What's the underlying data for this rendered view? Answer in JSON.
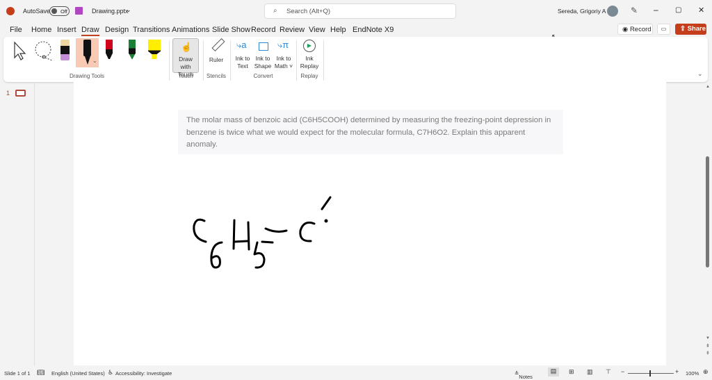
{
  "titlebar": {
    "autosave": "AutoSave",
    "toggle": "Off",
    "filename": "Drawing.pptx",
    "search_placeholder": "Search (Alt+Q)",
    "user": "Sereda, Grigoriy A"
  },
  "menu": [
    "File",
    "Home",
    "Insert",
    "Draw",
    "Design",
    "Transitions",
    "Animations",
    "Slide Show",
    "Record",
    "Review",
    "View",
    "Help",
    "EndNote X9"
  ],
  "actions": {
    "record": "Record",
    "share": "Share"
  },
  "ribbon": {
    "groups": {
      "drawing_tools": "Drawing Tools",
      "touch": "Touch",
      "stencils": "Stencils",
      "convert": "Convert",
      "replay": "Replay"
    },
    "tools": {
      "draw_touch_1": "Draw with",
      "draw_touch_2": "Touch",
      "ruler": "Ruler",
      "ink_text_1": "Ink to",
      "ink_text_2": "Text",
      "ink_shape_1": "Ink to",
      "ink_shape_2": "Shape",
      "ink_math_1": "Ink to",
      "ink_math_2": "Math ˅",
      "ink_replay_1": "Ink",
      "ink_replay_2": "Replay"
    },
    "pen_colors": {
      "black": "#000000",
      "red": "#d0021b",
      "green": "#1a7f37",
      "yellow": "#ffee00",
      "eraser_tip": "#c58fd8"
    }
  },
  "thumbnail": {
    "number": "1"
  },
  "slide": {
    "text": "The molar mass of benzoic acid (C6H5COOH) determined by measuring the freezing-point depression in benzene is twice what we would expect for the molecular formula, C7H6O2. Explain this apparent anomaly."
  },
  "status": {
    "slide": "Slide 1 of 1",
    "language": "English (United States)",
    "accessibility": "Accessibility: Investigate",
    "notes": "Notes",
    "zoom": "100%"
  }
}
